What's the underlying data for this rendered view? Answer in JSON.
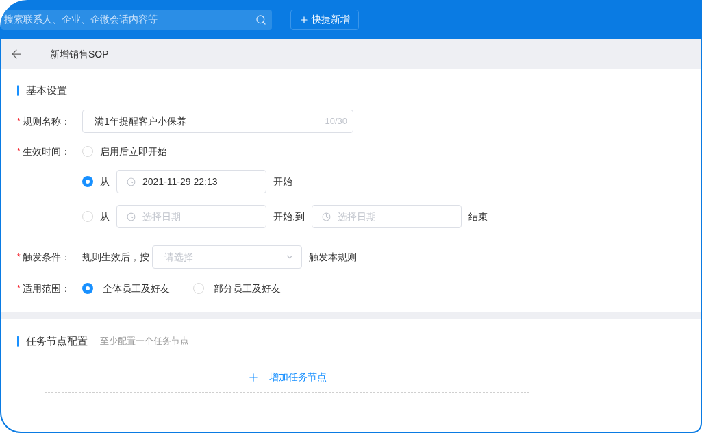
{
  "search": {
    "placeholder": "搜索联系人、企业、企微会话内容等"
  },
  "quick_add_button": {
    "label": "快捷新增"
  },
  "header": {
    "title": "新增销售SOP"
  },
  "basic_section": {
    "title": "基本设置"
  },
  "rule_name": {
    "label": "规则名称：",
    "required": "*",
    "value": "满1年提醒客户小保养",
    "counter": "10/30"
  },
  "effective_time": {
    "label": "生效时间：",
    "required": "*",
    "options": [
      {
        "kind": "immediate",
        "selected": false,
        "label": "启用后立即开始"
      },
      {
        "kind": "from",
        "selected": true,
        "prefix": "从",
        "date": {
          "value": "2021-11-29 22:13"
        },
        "suffix": "开始"
      },
      {
        "kind": "range",
        "selected": false,
        "prefix": "从",
        "start": {
          "placeholder": "选择日期"
        },
        "middle": "开始,到",
        "end": {
          "placeholder": "选择日期"
        },
        "suffix": "结束"
      }
    ]
  },
  "trigger": {
    "label": "触发条件：",
    "required": "*",
    "prefix": "规则生效后，按",
    "select": {
      "placeholder": "请选择"
    },
    "suffix": "触发本规则"
  },
  "scope": {
    "label": "适用范围：",
    "required": "*",
    "options": [
      {
        "label": "全体员工及好友",
        "selected": true
      },
      {
        "label": "部分员工及好友",
        "selected": false
      }
    ]
  },
  "task_section": {
    "title": "任务节点配置",
    "hint": "至少配置一个任务节点",
    "add_button": "增加任务节点"
  }
}
